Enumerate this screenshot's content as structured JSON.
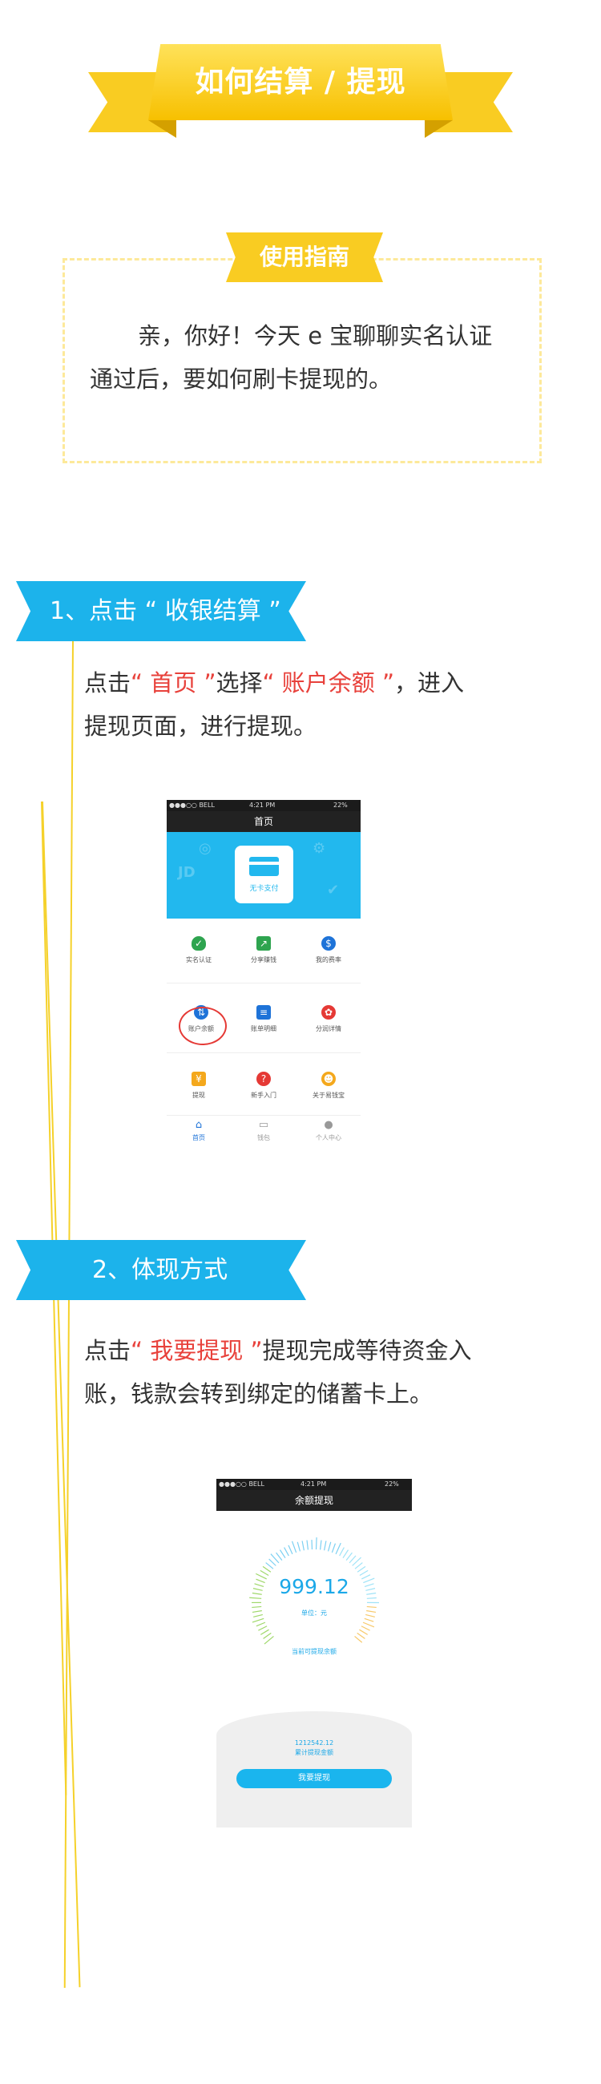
{
  "header": {
    "title": "如何结算 / 提现"
  },
  "guide": {
    "tag": "使用指南",
    "text_line1": "亲，你好！今天 e 宝聊聊实名认证",
    "text_line2": "通过后，要如何刷卡提现的。"
  },
  "section1": {
    "ribbon": "1、点击 “ 收银结算 ”",
    "text": {
      "a": "点击",
      "b": "“ 首页 ”",
      "c": "选择",
      "d": "“ 账户余额 ”",
      "e": "，进入",
      "line2": "提现页面，进行提现。"
    }
  },
  "phone1": {
    "status": {
      "carrier": "●●●○○ BELL",
      "time": "4:21 PM",
      "battery": "22%"
    },
    "nav_title": "首页",
    "hero_card_label": "无卡支付",
    "grid": [
      {
        "label": "实名认证",
        "icon": "shield-check-icon",
        "color": "#2ea44f"
      },
      {
        "label": "分享赚钱",
        "icon": "share-icon",
        "color": "#2ea44f"
      },
      {
        "label": "我的费率",
        "icon": "rate-icon",
        "color": "#1e73d8"
      },
      {
        "label": "账户余额",
        "icon": "balance-icon",
        "color": "#1e73d8"
      },
      {
        "label": "账单明细",
        "icon": "bill-icon",
        "color": "#1e73d8"
      },
      {
        "label": "分润详情",
        "icon": "profit-icon",
        "color": "#e53935"
      },
      {
        "label": "提现",
        "icon": "withdraw-icon",
        "color": "#f4a81c"
      },
      {
        "label": "新手入门",
        "icon": "help-icon",
        "color": "#e53935"
      },
      {
        "label": "关于易钱宝",
        "icon": "about-icon",
        "color": "#f4a81c"
      }
    ],
    "tabs": [
      {
        "label": "首页",
        "active": true
      },
      {
        "label": "钱包",
        "active": false
      },
      {
        "label": "个人中心",
        "active": false
      }
    ],
    "accent": "#22b8ee"
  },
  "section2": {
    "ribbon": "2、体现方式",
    "text": {
      "a": "点击",
      "b": "“ 我要提现 ”",
      "c": "提现完成等待资金入",
      "line2": "账，钱款会转到绑定的储蓄卡上。"
    }
  },
  "phone2": {
    "status": {
      "carrier": "●●●○○ BELL",
      "time": "4:21 PM",
      "battery": "22%"
    },
    "nav_title": "余额提现",
    "amount": "999.12",
    "unit": "单位：元",
    "available_label": "当前可提现余额",
    "total_value": "1212542.12",
    "total_label": "累计提现金额",
    "button": "我要提现"
  }
}
